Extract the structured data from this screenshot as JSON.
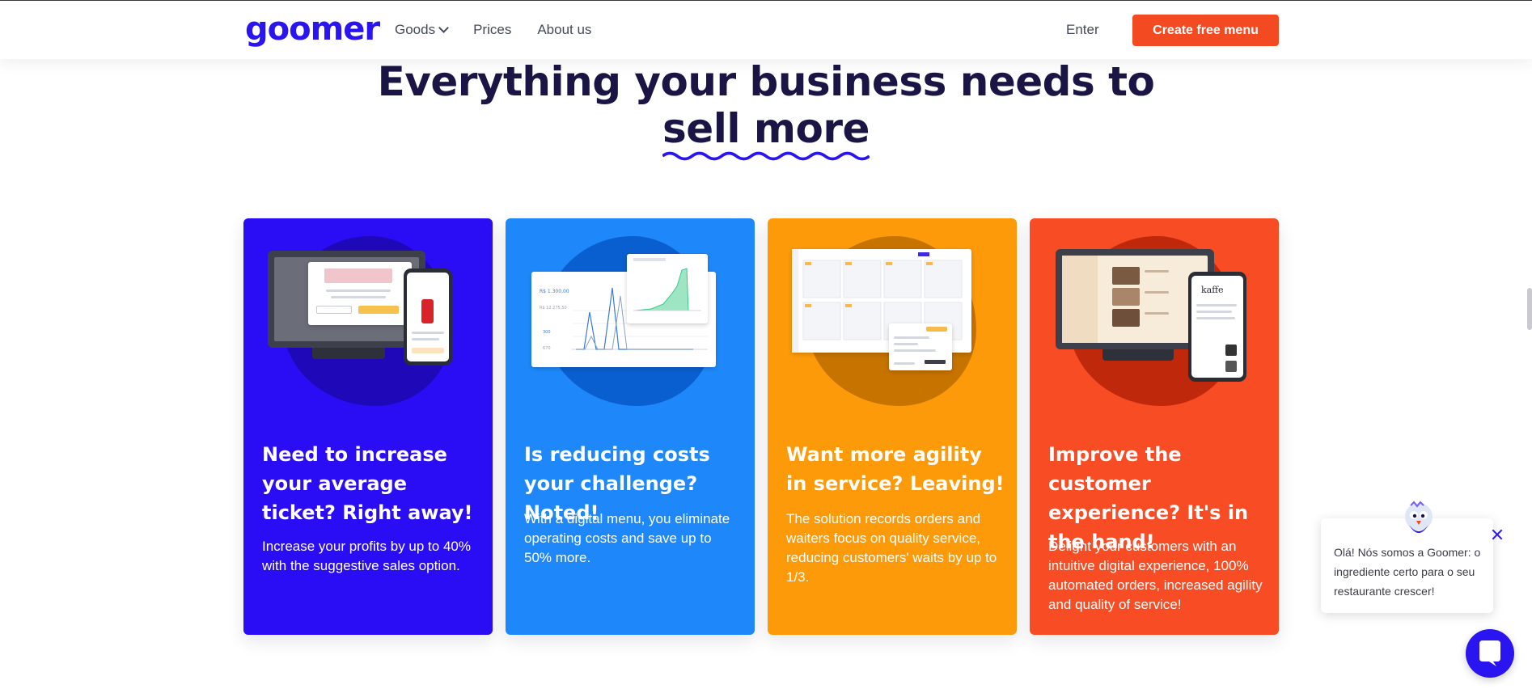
{
  "header": {
    "logo": "goomer",
    "nav": [
      {
        "label": "Goods",
        "has_dropdown": true
      },
      {
        "label": "Prices"
      },
      {
        "label": "About us"
      }
    ],
    "enter_label": "Enter",
    "cta_label": "Create free menu"
  },
  "hero": {
    "title_line1": "Everything your business needs to",
    "title_line2": "sell more"
  },
  "cards": [
    {
      "title": "Need to increase your average ticket? Right away!",
      "text": "Increase your profits by up to 40% with the suggestive sales option."
    },
    {
      "title": "Is reducing costs your challenge? Noted!",
      "text": "With a digital menu, you eliminate operating costs and save up to 50% more."
    },
    {
      "title": "Want more agility in service? Leaving!",
      "text": "The solution records orders and waiters focus on quality service, reducing customers' waits by up to 1/3."
    },
    {
      "title": "Improve the customer experience? It's in the hand!",
      "text": "Delight your customers with an intuitive digital experience, 100% automated orders, increased agility and quality of service!"
    }
  ],
  "chat": {
    "message": "Olá! Nós somos a Goomer: o ingrediente certo para o seu restaurante crescer!"
  },
  "colors": {
    "brand": "#2a14f0",
    "cta": "#f44a22",
    "card_blue": "#2a0cf5",
    "card_lightblue": "#1e88fa",
    "card_orange": "#fd9a0a",
    "card_red": "#f74c24"
  }
}
